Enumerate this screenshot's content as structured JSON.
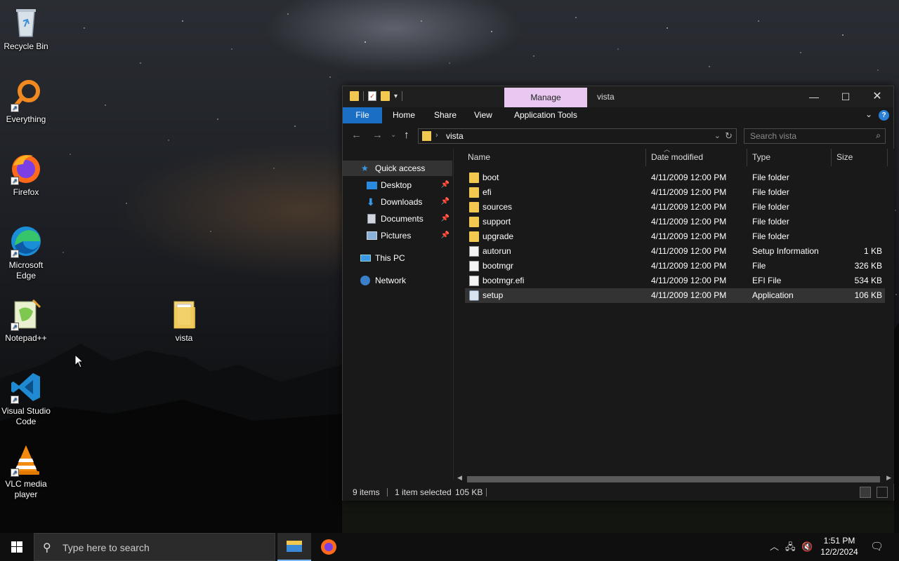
{
  "desktop": {
    "icons": [
      {
        "label": "Recycle Bin",
        "icon": "recycle-bin-icon"
      },
      {
        "label": "Everything",
        "icon": "everything-search-icon"
      },
      {
        "label": "Firefox",
        "icon": "firefox-icon"
      },
      {
        "label": "Microsoft Edge",
        "icon": "edge-icon"
      },
      {
        "label": "Notepad++",
        "icon": "notepad-plus-plus-icon"
      },
      {
        "label": "Visual Studio Code",
        "icon": "vscode-icon"
      },
      {
        "label": "VLC media player",
        "icon": "vlc-icon"
      },
      {
        "label": "vista",
        "icon": "folder-icon"
      }
    ]
  },
  "explorer": {
    "title": "vista",
    "context_tab": "Manage",
    "ribbon_tabs": [
      "File",
      "Home",
      "Share",
      "View",
      "Application Tools"
    ],
    "address_path": "vista",
    "search_placeholder": "Search vista",
    "nav": {
      "quick_access": "Quick access",
      "pinned": [
        "Desktop",
        "Downloads",
        "Documents",
        "Pictures"
      ],
      "this_pc": "This PC",
      "network": "Network"
    },
    "columns": [
      "Name",
      "Date modified",
      "Type",
      "Size"
    ],
    "files": [
      {
        "name": "boot",
        "date": "4/11/2009 12:00 PM",
        "type": "File folder",
        "size": "",
        "kind": "folder"
      },
      {
        "name": "efi",
        "date": "4/11/2009 12:00 PM",
        "type": "File folder",
        "size": "",
        "kind": "folder"
      },
      {
        "name": "sources",
        "date": "4/11/2009 12:00 PM",
        "type": "File folder",
        "size": "",
        "kind": "folder"
      },
      {
        "name": "support",
        "date": "4/11/2009 12:00 PM",
        "type": "File folder",
        "size": "",
        "kind": "folder"
      },
      {
        "name": "upgrade",
        "date": "4/11/2009 12:00 PM",
        "type": "File folder",
        "size": "",
        "kind": "folder"
      },
      {
        "name": "autorun",
        "date": "4/11/2009 12:00 PM",
        "type": "Setup Information",
        "size": "1 KB",
        "kind": "file"
      },
      {
        "name": "bootmgr",
        "date": "4/11/2009 12:00 PM",
        "type": "File",
        "size": "326 KB",
        "kind": "file"
      },
      {
        "name": "bootmgr.efi",
        "date": "4/11/2009 12:00 PM",
        "type": "EFI File",
        "size": "534 KB",
        "kind": "file"
      },
      {
        "name": "setup",
        "date": "4/11/2009 12:00 PM",
        "type": "Application",
        "size": "106 KB",
        "kind": "app",
        "selected": true
      }
    ],
    "status": {
      "items": "9 items",
      "selected": "1 item selected",
      "size": "105 KB"
    }
  },
  "taskbar": {
    "search_placeholder": "Type here to search",
    "time": "1:51 PM",
    "date": "12/2/2024"
  },
  "colors": {
    "accent_blue": "#1a6fc5",
    "manage_tab": "#e8c8f0",
    "folder_yellow": "#f3c850"
  }
}
